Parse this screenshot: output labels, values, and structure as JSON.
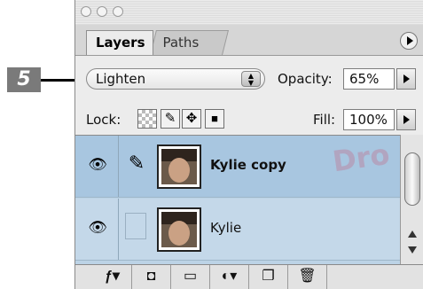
{
  "callout": {
    "step": "5"
  },
  "tabs": [
    {
      "label": "Layers"
    },
    {
      "label": "Paths"
    }
  ],
  "controls": {
    "blend_mode": "Lighten",
    "opacity_label": "Opacity:",
    "opacity_value": "65%",
    "lock_label": "Lock:",
    "fill_label": "Fill:",
    "fill_value": "100%"
  },
  "layers": [
    {
      "name": "Kylie copy",
      "selected": true
    },
    {
      "name": "Kylie",
      "selected": false
    }
  ],
  "watermark": "Dro",
  "icons": {
    "lock": [
      "lock-transparency-icon",
      "lock-paint-icon",
      "lock-move-icon",
      "lock-all-icon"
    ],
    "bottom": [
      "layer-style-icon",
      "layer-mask-icon",
      "new-set-icon",
      "adjustment-layer-icon",
      "new-layer-icon",
      "trash-icon"
    ]
  },
  "colors": {
    "selected_row": "#a8c6e0",
    "list_bg": "#bcd3e6",
    "watermark": "#c8506e"
  }
}
